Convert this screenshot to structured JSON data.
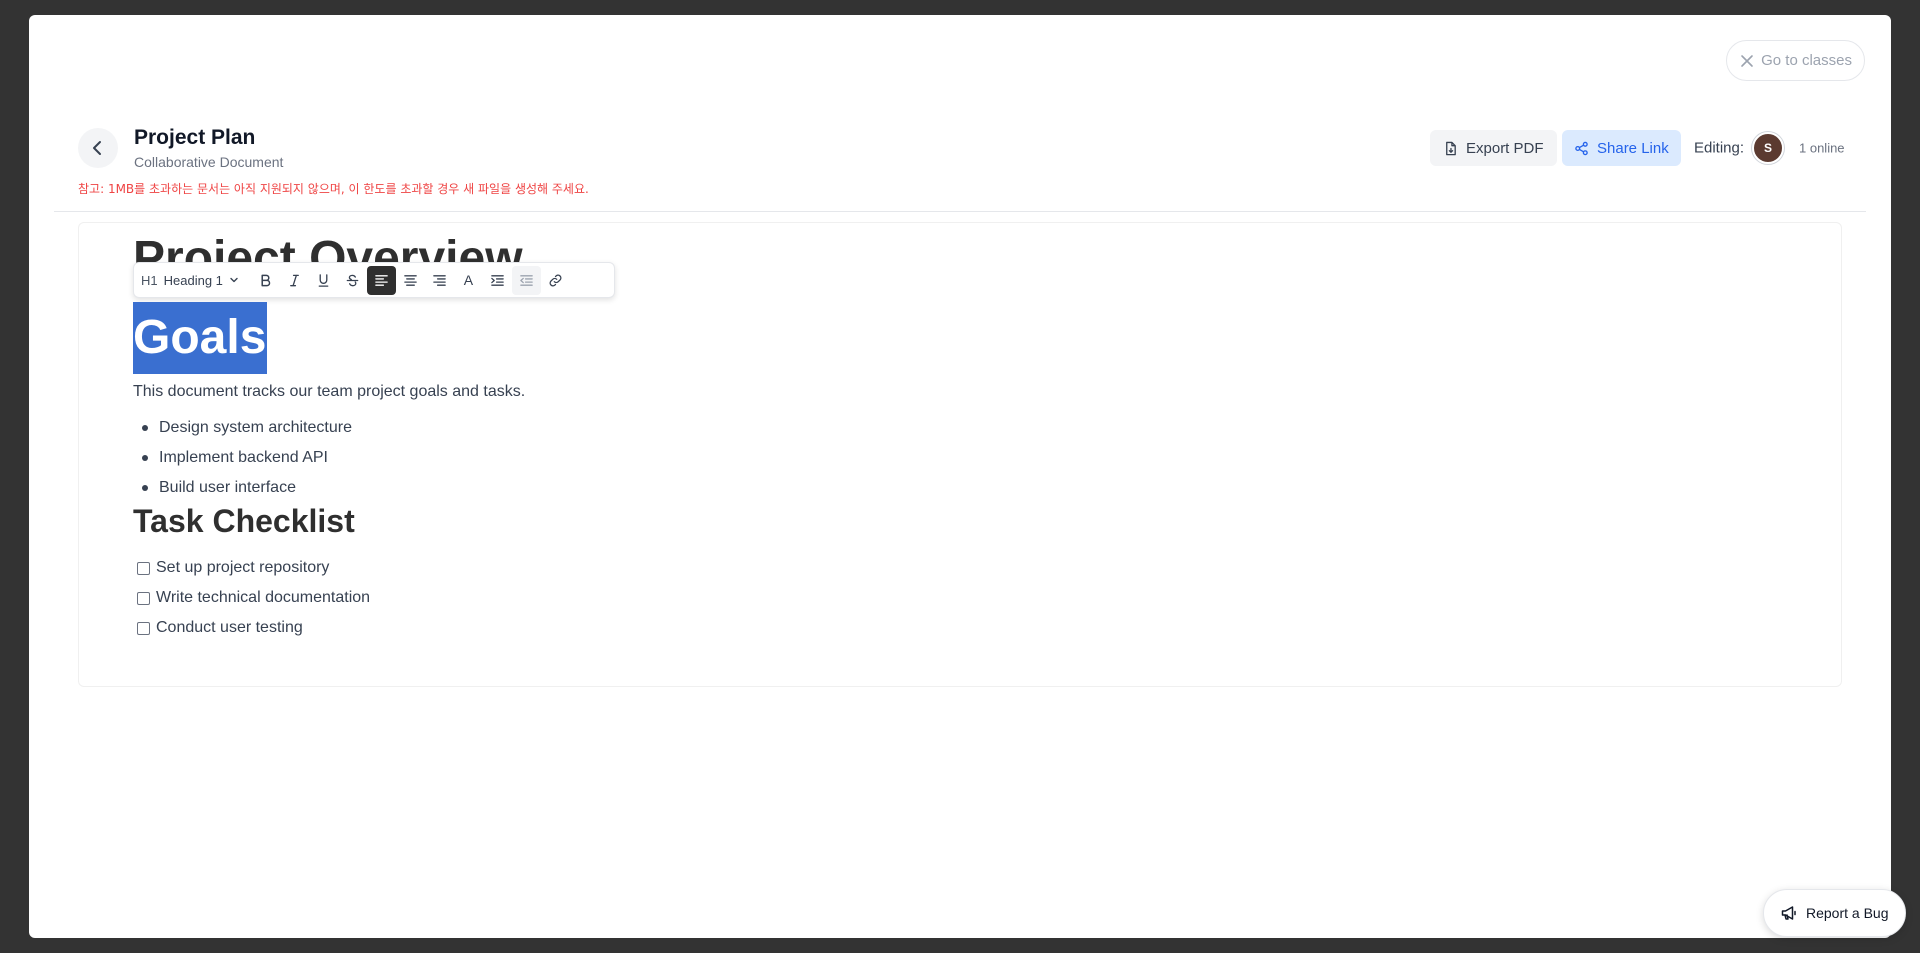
{
  "header": {
    "title": "Project Plan",
    "subtitle": "Collaborative Document",
    "notice": "참고: 1MB를 초과하는 문서는 아직 지원되지 않으며, 이 한도를 초과할 경우 새 파일을 생성해 주세요.",
    "go_to_classes": "Go to classes",
    "export_pdf": "Export PDF",
    "share_link": "Share Link",
    "editing_label": "Editing:",
    "avatar_initial": "S",
    "online_count": "1 online"
  },
  "toolbar": {
    "heading_glyph": "H1",
    "heading_select": "Heading 1",
    "text_color_glyph": "A",
    "active_align": "left"
  },
  "document": {
    "heading_overview": "Project Overview",
    "heading_goals": "Goals",
    "paragraph": "This document tracks our team project goals and tasks.",
    "bullets": [
      "Design system architecture",
      "Implement backend API",
      "Build user interface"
    ],
    "heading_tasks": "Task Checklist",
    "tasks": [
      "Set up project repository",
      "Write technical documentation",
      "Conduct user testing"
    ]
  },
  "footer": {
    "report_bug": "Report a Bug"
  },
  "colors": {
    "selection": "#3a6fd0",
    "share_bg": "#dbeafe",
    "share_text": "#2563eb",
    "notice": "#ef4444",
    "active_tool": "#2f2f2f"
  }
}
